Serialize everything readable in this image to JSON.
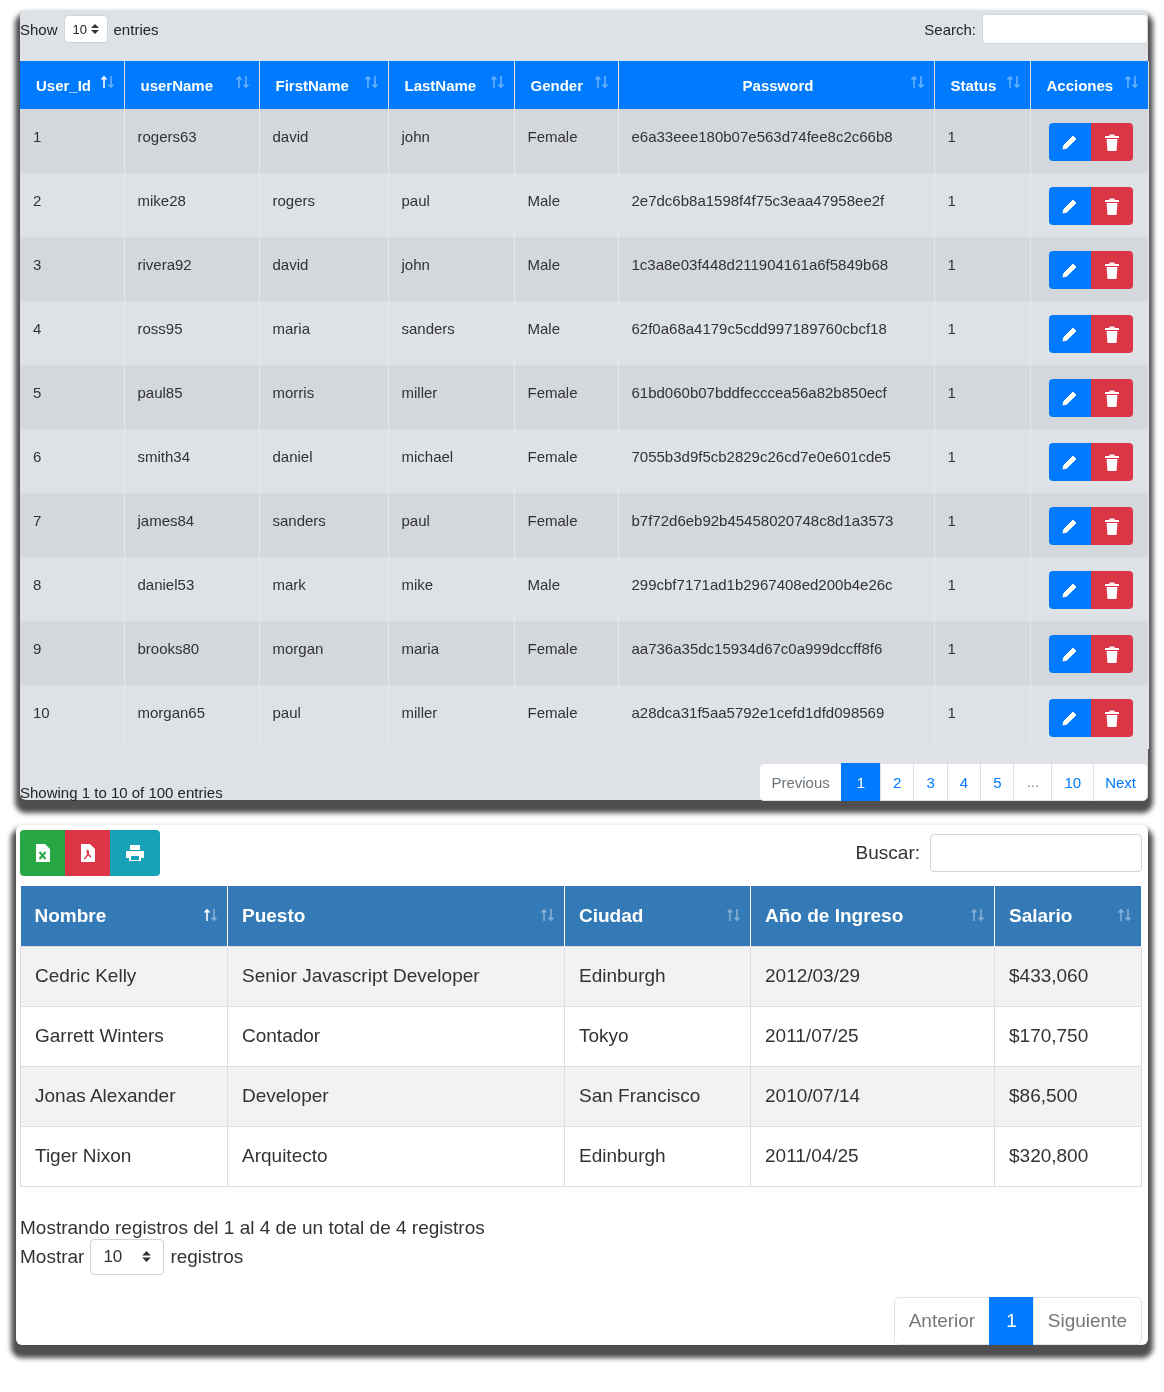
{
  "users_panel": {
    "length": {
      "label_before": "Show",
      "value": "10",
      "label_after": "entries"
    },
    "search": {
      "label": "Search:"
    },
    "columns": [
      {
        "label": "User_Id",
        "sorted_ascending": true
      },
      {
        "label": "userName",
        "sorted_ascending": false
      },
      {
        "label": "FirstName",
        "sorted_ascending": false
      },
      {
        "label": "LastName",
        "sorted_ascending": false
      },
      {
        "label": "Gender",
        "sorted_ascending": false
      },
      {
        "label": "Password",
        "sorted_ascending": false
      },
      {
        "label": "Status",
        "sorted_ascending": false
      },
      {
        "label": "Acciones",
        "sorted_ascending": false
      }
    ],
    "rows": [
      [
        "1",
        "rogers63",
        "david",
        "john",
        "Female",
        "e6a33eee180b07e563d74fee8c2c66b8",
        "1"
      ],
      [
        "2",
        "mike28",
        "rogers",
        "paul",
        "Male",
        "2e7dc6b8a1598f4f75c3eaa47958ee2f",
        "1"
      ],
      [
        "3",
        "rivera92",
        "david",
        "john",
        "Male",
        "1c3a8e03f448d211904161a6f5849b68",
        "1"
      ],
      [
        "4",
        "ross95",
        "maria",
        "sanders",
        "Male",
        "62f0a68a4179c5cdd997189760cbcf18",
        "1"
      ],
      [
        "5",
        "paul85",
        "morris",
        "miller",
        "Female",
        "61bd060b07bddfecccea56a82b850ecf",
        "1"
      ],
      [
        "6",
        "smith34",
        "daniel",
        "michael",
        "Female",
        "7055b3d9f5cb2829c26cd7e0e601cde5",
        "1"
      ],
      [
        "7",
        "james84",
        "sanders",
        "paul",
        "Female",
        "b7f72d6eb92b45458020748c8d1a3573",
        "1"
      ],
      [
        "8",
        "daniel53",
        "mark",
        "mike",
        "Male",
        "299cbf7171ad1b2967408ed200b4e26c",
        "1"
      ],
      [
        "9",
        "brooks80",
        "morgan",
        "maria",
        "Female",
        "aa736a35dc15934d67c0a999dccff8f6",
        "1"
      ],
      [
        "10",
        "morgan65",
        "paul",
        "miller",
        "Female",
        "a28dca31f5aa5792e1cefd1dfd098569",
        "1"
      ]
    ],
    "info": "Showing 1 to 10 of 100 entries",
    "pagination": [
      {
        "label": "Previous",
        "kind": "prev",
        "selected": false,
        "disabled": true
      },
      {
        "label": "1",
        "kind": "page",
        "selected": true,
        "disabled": false
      },
      {
        "label": "2",
        "kind": "page",
        "selected": false,
        "disabled": false
      },
      {
        "label": "3",
        "kind": "page",
        "selected": false,
        "disabled": false
      },
      {
        "label": "4",
        "kind": "page",
        "selected": false,
        "disabled": false
      },
      {
        "label": "5",
        "kind": "page",
        "selected": false,
        "disabled": false
      },
      {
        "label": "…",
        "kind": "ellipsis",
        "selected": false,
        "disabled": true
      },
      {
        "label": "10",
        "kind": "page",
        "selected": false,
        "disabled": false
      },
      {
        "label": "Next",
        "kind": "next",
        "selected": false,
        "disabled": false
      }
    ]
  },
  "employees_panel": {
    "search": {
      "label": "Buscar:"
    },
    "columns": [
      {
        "label": "Nombre",
        "sorted_ascending": true
      },
      {
        "label": "Puesto",
        "sorted_ascending": false
      },
      {
        "label": "Ciudad",
        "sorted_ascending": false
      },
      {
        "label": "Año de Ingreso",
        "sorted_ascending": false
      },
      {
        "label": "Salario",
        "sorted_ascending": false
      }
    ],
    "rows": [
      [
        "Cedric Kelly",
        "Senior Javascript Developer",
        "Edinburgh",
        "2012/03/29",
        "$433,060"
      ],
      [
        "Garrett Winters",
        "Contador",
        "Tokyo",
        "2011/07/25",
        "$170,750"
      ],
      [
        "Jonas Alexander",
        "Developer",
        "San Francisco",
        "2010/07/14",
        "$86,500"
      ],
      [
        "Tiger Nixon",
        "Arquitecto",
        "Edinburgh",
        "2011/04/25",
        "$320,800"
      ]
    ],
    "info": "Mostrando registros del 1 al 4 de un total de 4 registros",
    "length": {
      "label_before": "Mostrar",
      "value": "10",
      "label_after": "registros"
    },
    "pagination": [
      {
        "label": "Anterior",
        "kind": "prev",
        "selected": false,
        "disabled": true
      },
      {
        "label": "1",
        "kind": "page",
        "selected": true,
        "disabled": false
      },
      {
        "label": "Siguiente",
        "kind": "next",
        "selected": false,
        "disabled": true
      }
    ]
  }
}
